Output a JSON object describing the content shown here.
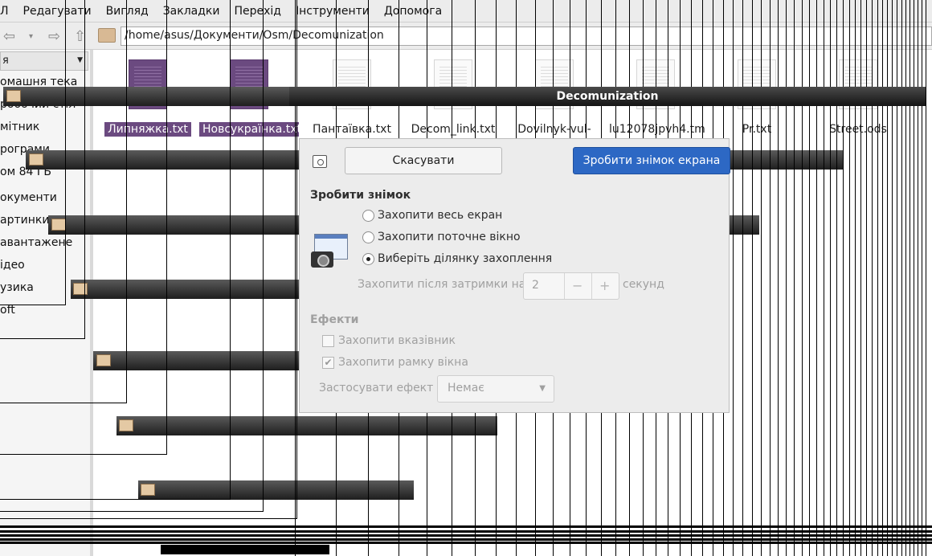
{
  "menubar": {
    "items": [
      "Л",
      "Редагувати",
      "Вигляд",
      "Закладки",
      "Перехід",
      "Інструменти",
      "Допомога"
    ]
  },
  "toolbar": {
    "location": "/home/asus/Документи/Osm/Decomunization"
  },
  "sidebar": {
    "header": "я",
    "places": [
      "омашня тека",
      "робочий стіл",
      "мітник",
      "рограми",
      "ом 84 ГБ",
      "окументи",
      "артинки",
      "авантажене",
      "ідео",
      "узика",
      "oft"
    ]
  },
  "files": [
    {
      "name": "Липняжка.txt",
      "selected": true
    },
    {
      "name": "Новсукраїнка.txt",
      "selected": true
    },
    {
      "name": "Пантаївка.txt",
      "selected": false
    },
    {
      "name": "Decom_link.txt",
      "selected": false
    },
    {
      "name": "Dovilnyk-vul-",
      "selected": false
    },
    {
      "name": "lu12078jpvh4.tmp",
      "selected": false
    },
    {
      "name": "Pr.txt",
      "selected": false
    },
    {
      "name": "Street.ods",
      "selected": false
    }
  ],
  "window_title": "Decomunization",
  "dialog": {
    "cancel_label": "Скасувати",
    "take_label": "Зробити знімок екрана",
    "section_take": "Зробити знімок",
    "options": [
      {
        "label": "Захопити весь екран",
        "checked": false
      },
      {
        "label": "Захопити поточне вікно",
        "checked": false
      },
      {
        "label": "Виберіть ділянку захоплення",
        "checked": true
      }
    ],
    "delay_label": "Захопити після затримки на",
    "delay_value": "2",
    "delay_minus": "−",
    "delay_plus": "+",
    "delay_unit": "секунд",
    "section_effects": "Ефекти",
    "effects": [
      {
        "label": "Захопити вказівник",
        "checked": false
      },
      {
        "label": "Захопити рамку вікна",
        "checked": true
      }
    ],
    "apply_effect_label": "Застосувати ефект",
    "apply_effect_value": "Немає"
  },
  "colors": {
    "accent_blue": "#2d68c4",
    "selection_purple": "#6b4a80"
  }
}
